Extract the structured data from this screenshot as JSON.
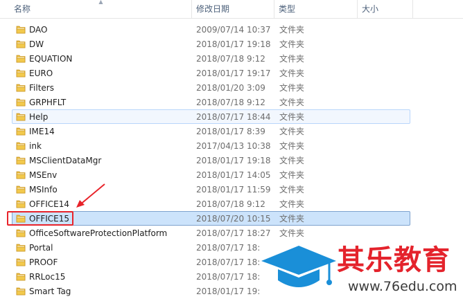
{
  "header": {
    "name": "名称",
    "date_modified": "修改日期",
    "type": "类型",
    "size": "大小"
  },
  "rows": [
    {
      "name": "DAO",
      "date": "2009/07/14 10:37",
      "type": "文件夹"
    },
    {
      "name": "DW",
      "date": "2018/01/17 19:18",
      "type": "文件夹"
    },
    {
      "name": "EQUATION",
      "date": "2018/07/18 9:12",
      "type": "文件夹"
    },
    {
      "name": "EURO",
      "date": "2018/01/17 19:17",
      "type": "文件夹"
    },
    {
      "name": "Filters",
      "date": "2018/01/20 3:09",
      "type": "文件夹"
    },
    {
      "name": "GRPHFLT",
      "date": "2018/07/18 9:12",
      "type": "文件夹"
    },
    {
      "name": "Help",
      "date": "2018/07/17 18:44",
      "type": "文件夹"
    },
    {
      "name": "IME14",
      "date": "2018/01/17 8:39",
      "type": "文件夹"
    },
    {
      "name": "ink",
      "date": "2017/04/13 10:38",
      "type": "文件夹"
    },
    {
      "name": "MSClientDataMgr",
      "date": "2018/01/17 19:18",
      "type": "文件夹"
    },
    {
      "name": "MSEnv",
      "date": "2018/01/17 14:05",
      "type": "文件夹"
    },
    {
      "name": "MSInfo",
      "date": "2018/01/17 11:59",
      "type": "文件夹"
    },
    {
      "name": "OFFICE14",
      "date": "2018/07/18 9:12",
      "type": "文件夹"
    },
    {
      "name": "OFFICE15",
      "date": "2018/07/20 10:15",
      "type": "文件夹"
    },
    {
      "name": "OfficeSoftwareProtectionPlatform",
      "date": "2018/07/17 18:27",
      "type": "文件夹"
    },
    {
      "name": "Portal",
      "date": "2018/07/17 18:",
      "type": ""
    },
    {
      "name": "PROOF",
      "date": "2018/07/17 18:",
      "type": ""
    },
    {
      "name": "RRLoc15",
      "date": "2018/07/17 18:",
      "type": ""
    },
    {
      "name": "Smart Tag",
      "date": "2018/01/17 19:",
      "type": ""
    }
  ],
  "hover_row": 6,
  "selected_row": 13,
  "watermark": {
    "title": "其乐教育",
    "url": "www.76edu.com"
  },
  "colors": {
    "folder": "#e8b93a",
    "selection": "#cce3fb",
    "annotation": "#e8232a",
    "watermark_blue": "#1a8fd8"
  }
}
